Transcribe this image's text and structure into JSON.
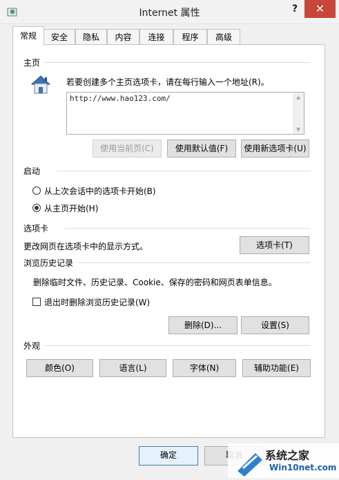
{
  "window": {
    "title": "Internet 属性"
  },
  "title_buttons": {
    "help": "?",
    "close": "✕"
  },
  "tabs": [
    {
      "label": "常规",
      "active": true
    },
    {
      "label": "安全",
      "active": false
    },
    {
      "label": "隐私",
      "active": false
    },
    {
      "label": "内容",
      "active": false
    },
    {
      "label": "连接",
      "active": false
    },
    {
      "label": "程序",
      "active": false
    },
    {
      "label": "高级",
      "active": false
    }
  ],
  "homepage": {
    "group_title": "主页",
    "instruction": "若要创建多个主页选项卡，请在每行输入一个地址(R)。",
    "url_value": "http://www.hao123.com/",
    "buttons": {
      "use_current": "使用当前页(C)",
      "use_default": "使用默认值(F)",
      "use_new_tab": "使用新选项卡(U)"
    }
  },
  "startup": {
    "group_title": "启动",
    "options": [
      {
        "label": "从上次会话中的选项卡开始(B)",
        "checked": false
      },
      {
        "label": "从主页开始(H)",
        "checked": true
      }
    ]
  },
  "tabs_section": {
    "group_title": "选项卡",
    "description": "更改网页在选项卡中的显示方式。",
    "button": "选项卡(T)"
  },
  "history": {
    "group_title": "浏览历史记录",
    "description": "删除临时文件、历史记录、Cookie、保存的密码和网页表单信息。",
    "checkbox_label": "退出时删除浏览历史记录(W)",
    "checkbox_checked": false,
    "delete_button": "删除(D)...",
    "settings_button": "设置(S)"
  },
  "appearance": {
    "group_title": "外观",
    "buttons": [
      "颜色(O)",
      "语言(L)",
      "字体(N)",
      "辅助功能(E)"
    ]
  },
  "footer": {
    "ok": "确定",
    "cancel": "取消"
  },
  "watermark": {
    "brand": "系统之家",
    "domain": "Win10net.com"
  },
  "colors": {
    "close_button": "#c7453a",
    "ok_border": "#3c7fb1",
    "watermark_domain": "#1a5fa8"
  }
}
